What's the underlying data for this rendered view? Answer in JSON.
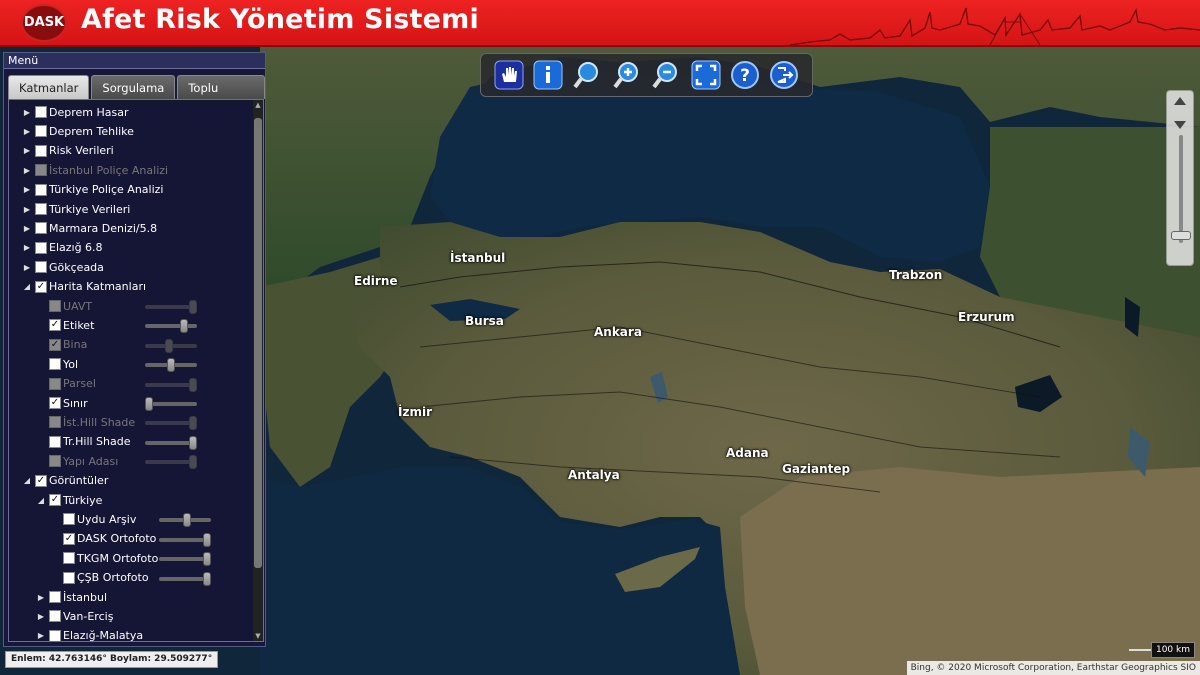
{
  "header": {
    "logo_text": "DASK",
    "title": "Afet Risk Yönetim Sistemi"
  },
  "toolbar": {
    "tools": [
      {
        "icon": "pan-hand-icon"
      },
      {
        "icon": "info-icon"
      },
      {
        "icon": "search-zoom-icon"
      },
      {
        "icon": "zoom-in-icon"
      },
      {
        "icon": "zoom-out-icon"
      },
      {
        "icon": "full-extent-icon"
      },
      {
        "icon": "help-icon"
      },
      {
        "icon": "exit-icon"
      }
    ]
  },
  "menu": {
    "title": "Menü",
    "tabs": [
      "Katmanlar",
      "Sorgulama",
      "Toplu Poliçe"
    ],
    "active_tab": "Katmanlar",
    "layers": [
      {
        "label": "Deprem Hasar",
        "checked": false
      },
      {
        "label": "Deprem Tehlike",
        "checked": false
      },
      {
        "label": "Risk Verileri",
        "checked": false
      },
      {
        "label": "İstanbul Poliçe Analizi",
        "checked": false,
        "disabled": true
      },
      {
        "label": "Türkiye Poliçe Analizi",
        "checked": false
      },
      {
        "label": "Türkiye Verileri",
        "checked": false
      },
      {
        "label": "Marmara Denizi/5.8",
        "checked": false
      },
      {
        "label": "Elazığ 6.8",
        "checked": false
      },
      {
        "label": "Gökçeada",
        "checked": false
      },
      {
        "label": "Harita Katmanları",
        "checked": true,
        "expanded": true
      },
      {
        "label": "UAVT",
        "checked": false,
        "disabled": true,
        "opacity": 1.0
      },
      {
        "label": "Etiket",
        "checked": true,
        "opacity": 0.8
      },
      {
        "label": "Bina",
        "checked": true,
        "disabled": true,
        "opacity": 0.45
      },
      {
        "label": "Yol",
        "checked": false,
        "opacity": 0.5
      },
      {
        "label": "Parsel",
        "checked": false,
        "disabled": true,
        "opacity": 1.0
      },
      {
        "label": "Sınır",
        "checked": true,
        "opacity": 0.0
      },
      {
        "label": "İst.Hill Shade",
        "checked": false,
        "disabled": true,
        "opacity": 1.0
      },
      {
        "label": "Tr.Hill Shade",
        "checked": false,
        "opacity": 1.0
      },
      {
        "label": "Yapı Adası",
        "checked": false,
        "disabled": true,
        "opacity": 1.0
      },
      {
        "label": "Görüntüler",
        "checked": true,
        "expanded": true
      },
      {
        "label": "Türkiye",
        "checked": true,
        "expanded": true
      },
      {
        "label": "Uydu Arşiv",
        "checked": false,
        "opacity": 0.55
      },
      {
        "label": "DASK Ortofoto",
        "checked": true,
        "opacity": 1.0
      },
      {
        "label": "TKGM Ortofoto",
        "checked": false,
        "opacity": 1.0
      },
      {
        "label": "ÇŞB Ortofoto",
        "checked": false,
        "opacity": 1.0
      },
      {
        "label": "İstanbul",
        "checked": false
      },
      {
        "label": "Van-Erciş",
        "checked": false
      },
      {
        "label": "Elazığ-Malatya",
        "checked": false
      }
    ]
  },
  "map": {
    "cities": [
      "İstanbul",
      "Edirne",
      "Bursa",
      "Ankara",
      "Trabzon",
      "Erzurum",
      "İzmir",
      "Antalya",
      "Adana",
      "Gaziantep"
    ],
    "colors": {
      "sea": "#12283d",
      "land": "#5a5a3c",
      "forest": "#2f4a2a",
      "header": "#e21b1b"
    }
  },
  "status": {
    "coordinates": "Enlem: 42.763146° Boylam: 29.509277°",
    "scale": "100 km",
    "attribution": "Bing, © 2020 Microsoft Corporation, Earthstar Geographics SIO"
  }
}
